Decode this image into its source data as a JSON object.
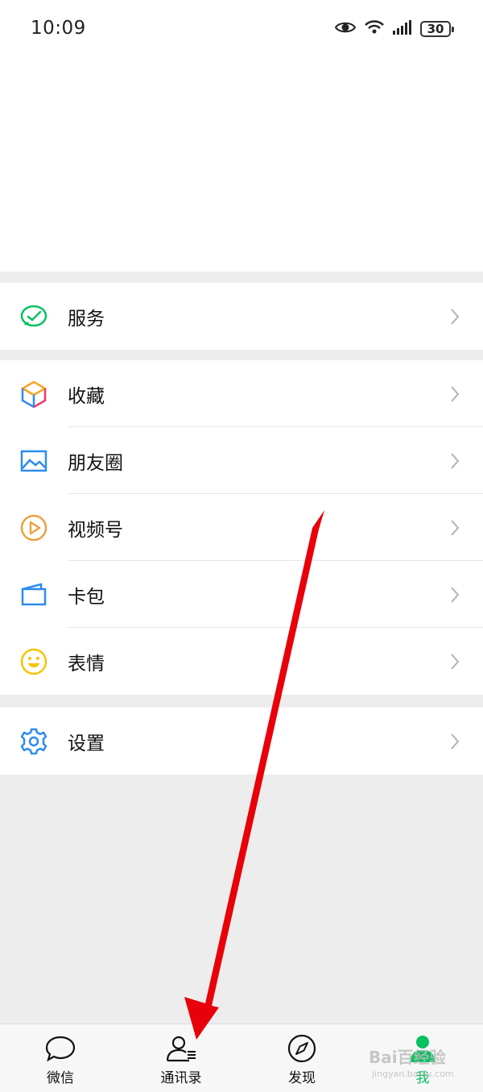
{
  "status_bar": {
    "time": "10:09",
    "battery": "30"
  },
  "menu": {
    "service": {
      "label": "服务"
    },
    "group2": [
      {
        "label": "收藏"
      },
      {
        "label": "朋友圈"
      },
      {
        "label": "视频号"
      },
      {
        "label": "卡包"
      },
      {
        "label": "表情"
      }
    ],
    "settings": {
      "label": "设置"
    }
  },
  "tabbar": {
    "tabs": [
      {
        "label": "微信"
      },
      {
        "label": "通讯录"
      },
      {
        "label": "发现"
      },
      {
        "label": "我"
      }
    ]
  },
  "watermark": {
    "brand": "Bai百经验",
    "url": "jingyan.baidu.com"
  },
  "colors": {
    "accent": "#07c160",
    "arrow": "#e8000a"
  }
}
